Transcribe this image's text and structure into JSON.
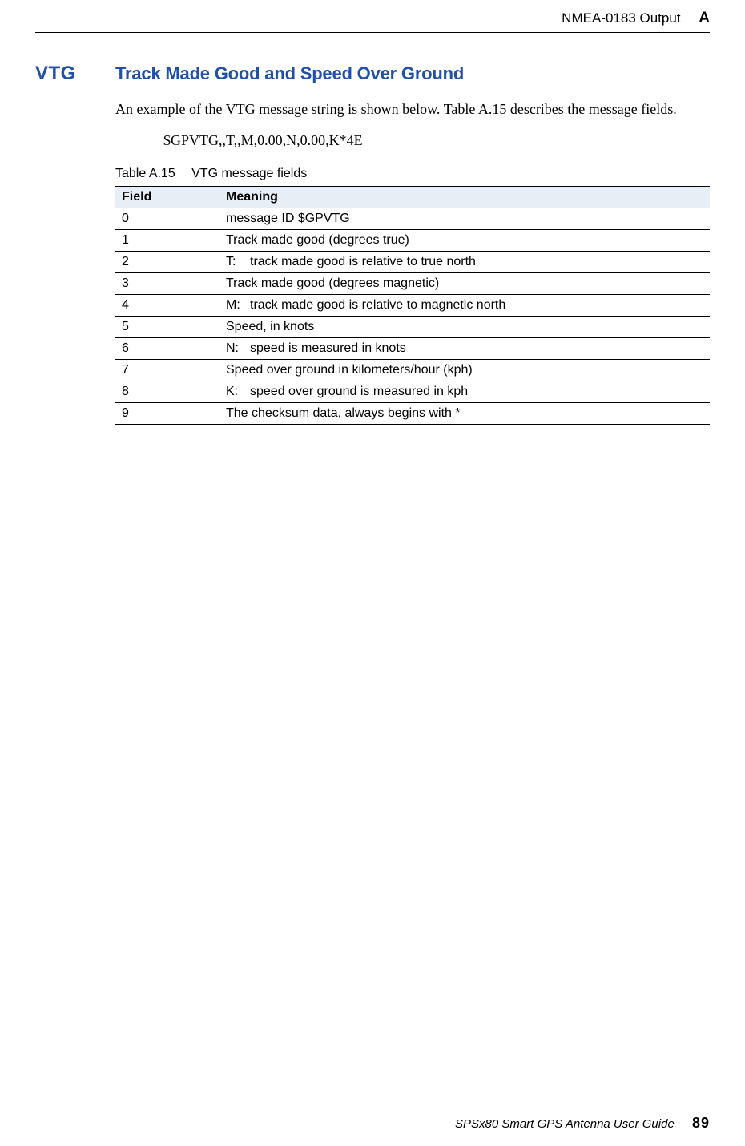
{
  "header": {
    "text": "NMEA-0183 Output",
    "appendix": "A"
  },
  "section": {
    "code": "VTG",
    "title": "Track Made Good and Speed Over Ground",
    "body": "An example of the VTG message string is shown below. Table A.15 describes the message fields.",
    "example": "$GPVTG,,T,,M,0.00,N,0.00,K*4E"
  },
  "table": {
    "caption_num": "Table A.15",
    "caption_title": "VTG message fields",
    "headers": {
      "field": "Field",
      "meaning": "Meaning"
    },
    "rows": [
      {
        "field": "0",
        "code": "",
        "meaning": "message ID $GPVTG"
      },
      {
        "field": "1",
        "code": "",
        "meaning": "Track made good (degrees true)"
      },
      {
        "field": "2",
        "code": "T:",
        "meaning": "track made good is relative to true north"
      },
      {
        "field": "3",
        "code": "",
        "meaning": "Track made good (degrees magnetic)"
      },
      {
        "field": "4",
        "code": "M:",
        "meaning": "track made good is relative to magnetic north"
      },
      {
        "field": "5",
        "code": "",
        "meaning": "Speed, in knots"
      },
      {
        "field": "6",
        "code": "N:",
        "meaning": "speed is measured in knots"
      },
      {
        "field": "7",
        "code": "",
        "meaning": "Speed over ground in kilometers/hour (kph)"
      },
      {
        "field": "8",
        "code": "K:",
        "meaning": "speed over ground is measured in kph"
      },
      {
        "field": "9",
        "code": "",
        "meaning": "The checksum data, always begins with *"
      }
    ]
  },
  "footer": {
    "title": "SPSx80 Smart GPS Antenna User Guide",
    "page": "89"
  }
}
